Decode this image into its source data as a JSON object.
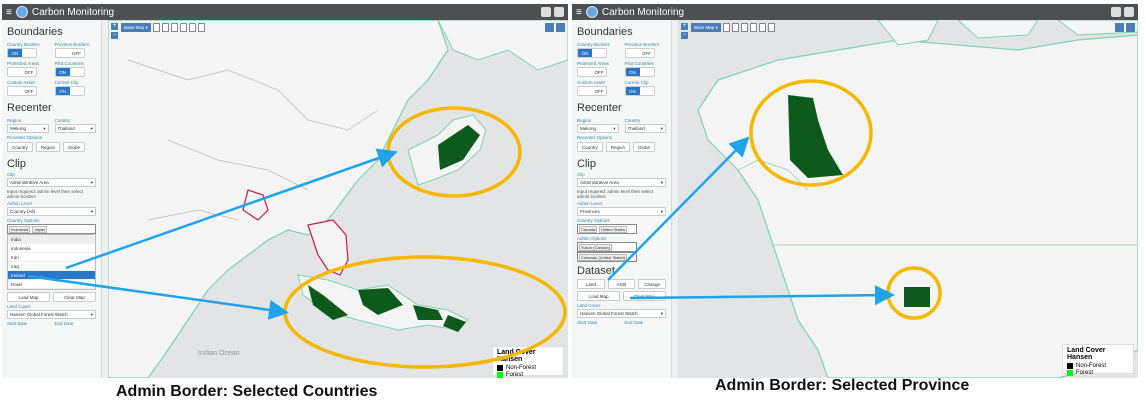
{
  "app_title": "Carbon Monitoring",
  "colors": {
    "topbar": "#4d4f53",
    "accent": "#2a77c8",
    "highlight_circle": "#f5b800",
    "arrow": "#1fa3ea",
    "forest": "#00ff00",
    "non_forest": "#000000"
  },
  "left": {
    "boundaries": {
      "title": "Boundaries",
      "country_borders": {
        "label": "Country Borders",
        "on": "ON",
        "off": "OFF"
      },
      "province_borders": {
        "label": "Province Borders",
        "off": "OFF"
      },
      "protected_areas": {
        "label": "Protected Areas",
        "off": "OFF"
      },
      "pilot_countries": {
        "label": "Pilot Countries",
        "on": "ON"
      },
      "custom_asset": {
        "label": "Custom Asset",
        "off": "OFF"
      },
      "current_clip": {
        "label": "Current Clip",
        "on": "ON"
      }
    },
    "recenter": {
      "title": "Recenter",
      "region_label": "Region",
      "region_value": "Mekong",
      "country_label": "Country",
      "country_value": "Thailand",
      "options_label": "Recenter Options",
      "buttons": [
        "Country",
        "Region",
        "Globe"
      ]
    },
    "clip": {
      "title": "Clip",
      "clip_label": "Clip",
      "clip_value": "Administrative Area",
      "note": "Input required: admin level then select admin borders",
      "admin_level_label": "Admin Level",
      "admin_level_value": "Country (All)",
      "options_label": "Country Options",
      "tags": [
        "Indonesia",
        "Japan"
      ],
      "search_text": "India",
      "dropdown": [
        "Indonesia",
        "Iran",
        "Iraq",
        "Ireland",
        "Israel"
      ],
      "dropdown_selected": "Ireland",
      "load_map": "Load Map",
      "clear_map": "Clear Map"
    },
    "land_cover": {
      "label": "Land Cover",
      "value": "Hansen Global Forest Watch"
    },
    "start_date": "Start Date",
    "end_date": "End Date",
    "map": {
      "basemap_button": "Base Map ▾",
      "ocean_label": "Indian Ocean"
    }
  },
  "right": {
    "clip": {
      "title": "Clip",
      "clip_label": "Clip",
      "clip_value": "Administrative Area",
      "note": "Input required: admin level then select admin borders",
      "admin_level_label": "Admin Level",
      "admin_level_value": "Provinces",
      "country_options_label": "Country Options",
      "country_tags": [
        "Canada",
        "United States"
      ],
      "admin_options_label": "Admin Options",
      "admin_tags": [
        "Yukon (Canada)",
        "Colorado (United States)"
      ]
    },
    "dataset": {
      "title": "Dataset",
      "buttons": [
        "Land",
        "AGB",
        "Change"
      ],
      "load_map": "Load Map",
      "clear_map": "Clear Map"
    },
    "land_cover": {
      "label": "Land Cover",
      "value": "Hansen Global Forest Watch"
    },
    "start_date": "Start Date",
    "end_date": "End Date",
    "map": {
      "basemap_button": "Base Map ▾"
    }
  },
  "legend": {
    "title": "Land Cover Hansen",
    "items": [
      {
        "label": "Non-Forest",
        "color": "#000000"
      },
      {
        "label": "Forest",
        "color": "#00ff00"
      }
    ]
  },
  "captions": {
    "left": "Admin Border: Selected Countries",
    "right": "Admin Border: Selected Province"
  }
}
